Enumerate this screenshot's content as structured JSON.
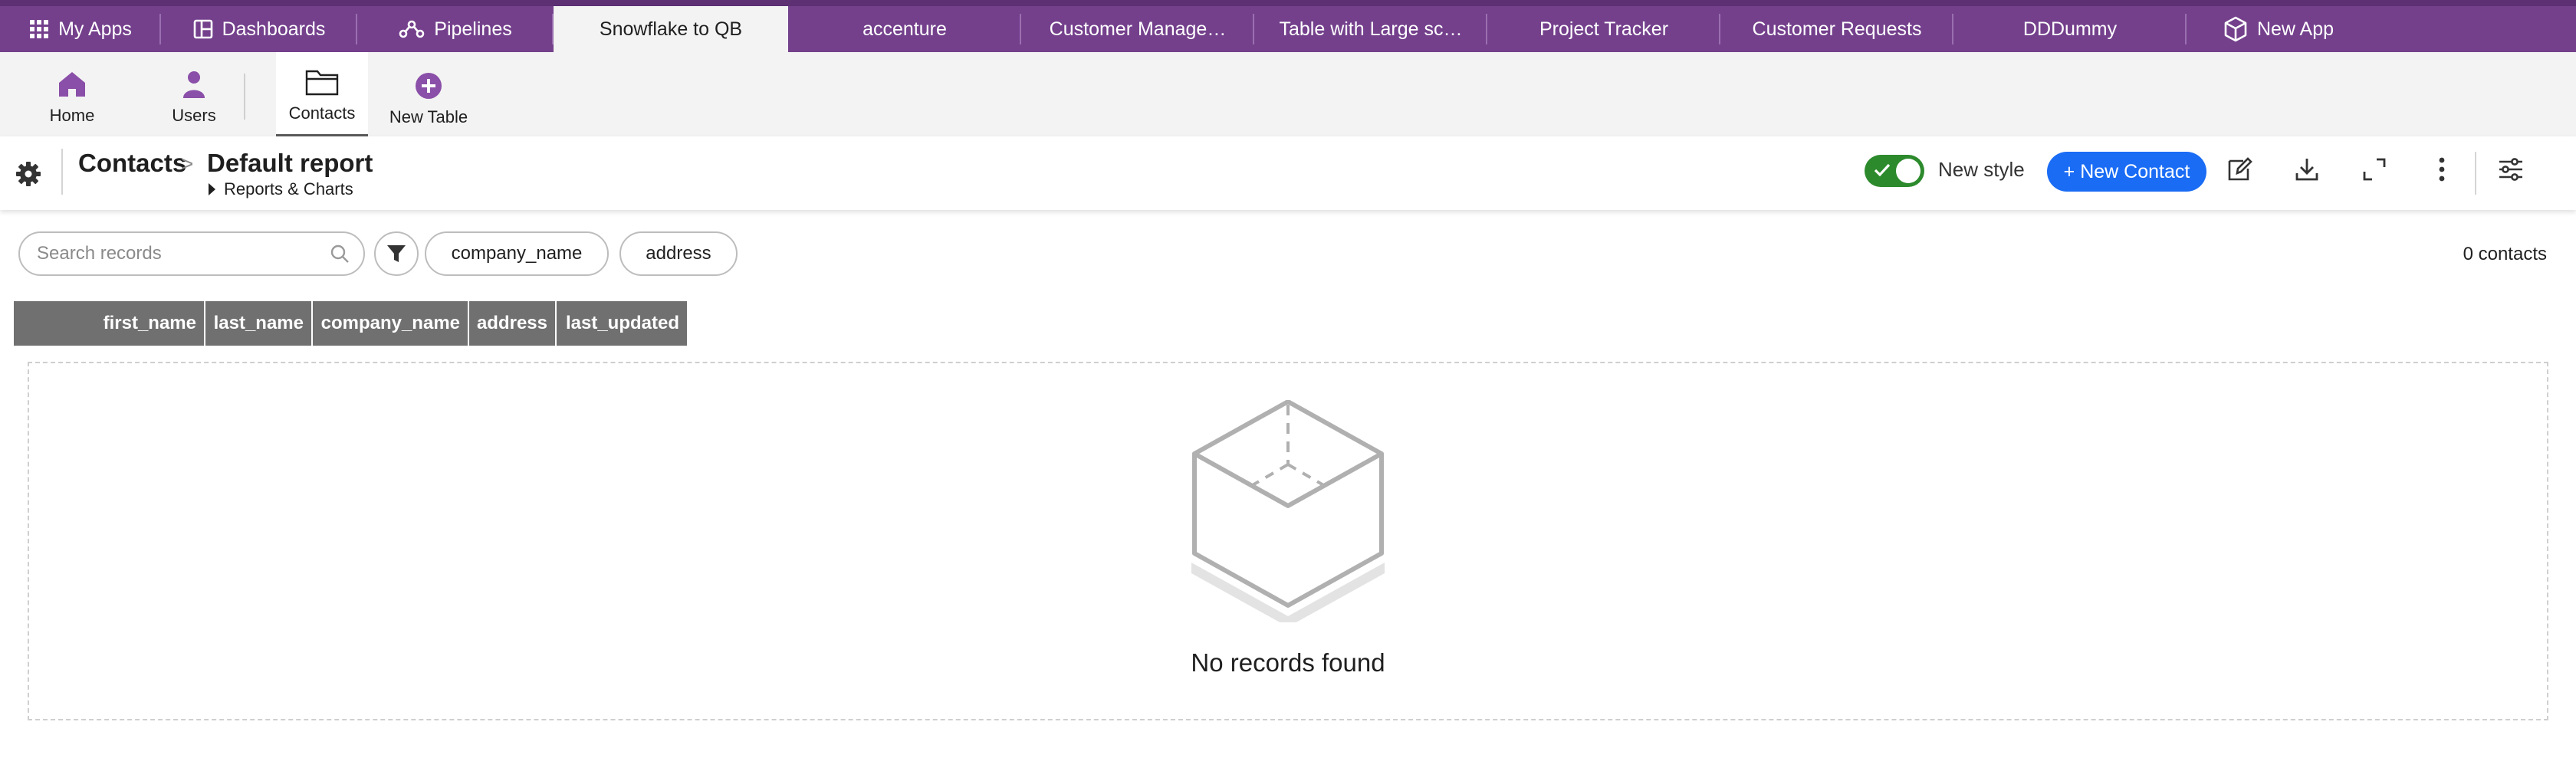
{
  "topbar": {
    "my_apps": "My Apps",
    "dashboards": "Dashboards",
    "pipelines": "Pipelines",
    "app_tabs": [
      "Snowflake to QB",
      "accenture",
      "Customer Manage…",
      "Table with Large sc…",
      "Project Tracker",
      "Customer Requests",
      "DDDummy"
    ],
    "new_app": "New App",
    "active_tab": "Snowflake to QB"
  },
  "appbar": {
    "home": "Home",
    "users": "Users",
    "contacts": "Contacts",
    "new_table": "New Table"
  },
  "report": {
    "table_name": "Contacts",
    "separator": ">",
    "report_name": "Default report",
    "reports_charts": "Reports & Charts",
    "new_style_label": "New style",
    "new_style_on": true,
    "new_button": "+ New Contact"
  },
  "search": {
    "placeholder": "Search records",
    "value": ""
  },
  "filters": {
    "chips": [
      "company_name",
      "address"
    ]
  },
  "record_count": "0 contacts",
  "table": {
    "columns": [
      "first_name",
      "last_name",
      "company_name",
      "address",
      "last_updated"
    ]
  },
  "empty_state": {
    "message": "No records found"
  },
  "colors": {
    "brand_purple": "#74408c",
    "primary_blue": "#1a6cf5",
    "toggle_green": "#2c8a2c",
    "header_gray": "#707070"
  }
}
